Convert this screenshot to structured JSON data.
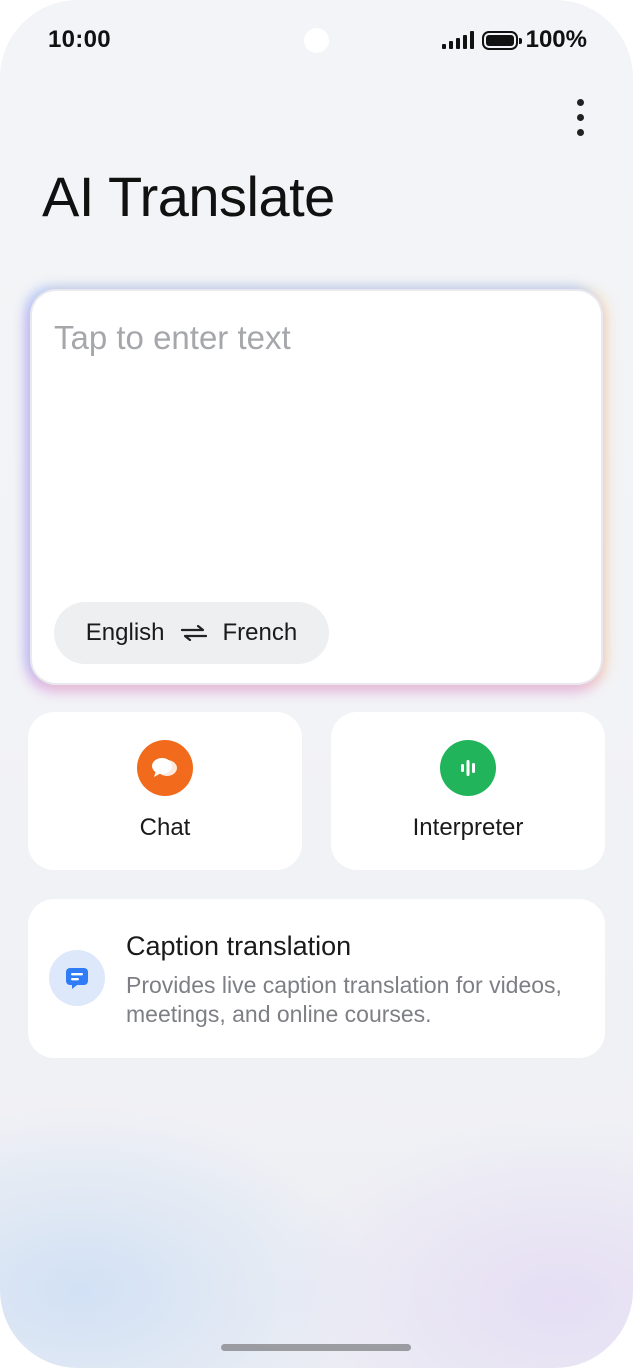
{
  "status_bar": {
    "time": "10:00",
    "battery_percent": "100%"
  },
  "header": {
    "title": "AI Translate",
    "more_icon": "more-vertical-icon"
  },
  "input_card": {
    "placeholder": "Tap to enter text",
    "source_language": "English",
    "target_language": "French",
    "swap_icon": "swap-arrows-icon"
  },
  "features": [
    {
      "label": "Chat",
      "icon": "chat-bubbles-icon",
      "color": "#f26a1b"
    },
    {
      "label": "Interpreter",
      "icon": "sound-wave-icon",
      "color": "#22b45a"
    }
  ],
  "caption_card": {
    "title": "Caption translation",
    "description": "Provides live caption translation for videos, meetings, and online courses.",
    "icon": "caption-icon",
    "icon_color": "#2f7cf6"
  }
}
